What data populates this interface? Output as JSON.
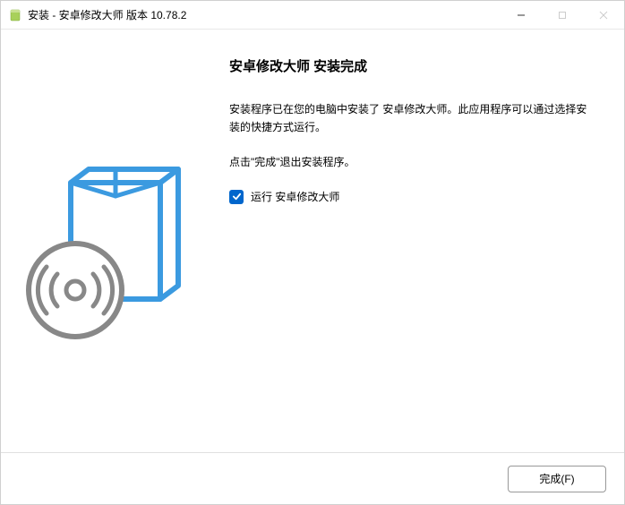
{
  "titlebar": {
    "text": "安装 - 安卓修改大师 版本 10.78.2"
  },
  "content": {
    "heading": "安卓修改大师 安装完成",
    "paragraph1": "安装程序已在您的电脑中安装了 安卓修改大师。此应用程序可以通过选择安装的快捷方式运行。",
    "paragraph2": "点击\"完成\"退出安装程序。",
    "checkbox_label": "运行 安卓修改大师"
  },
  "footer": {
    "finish_button": "完成(F)"
  }
}
